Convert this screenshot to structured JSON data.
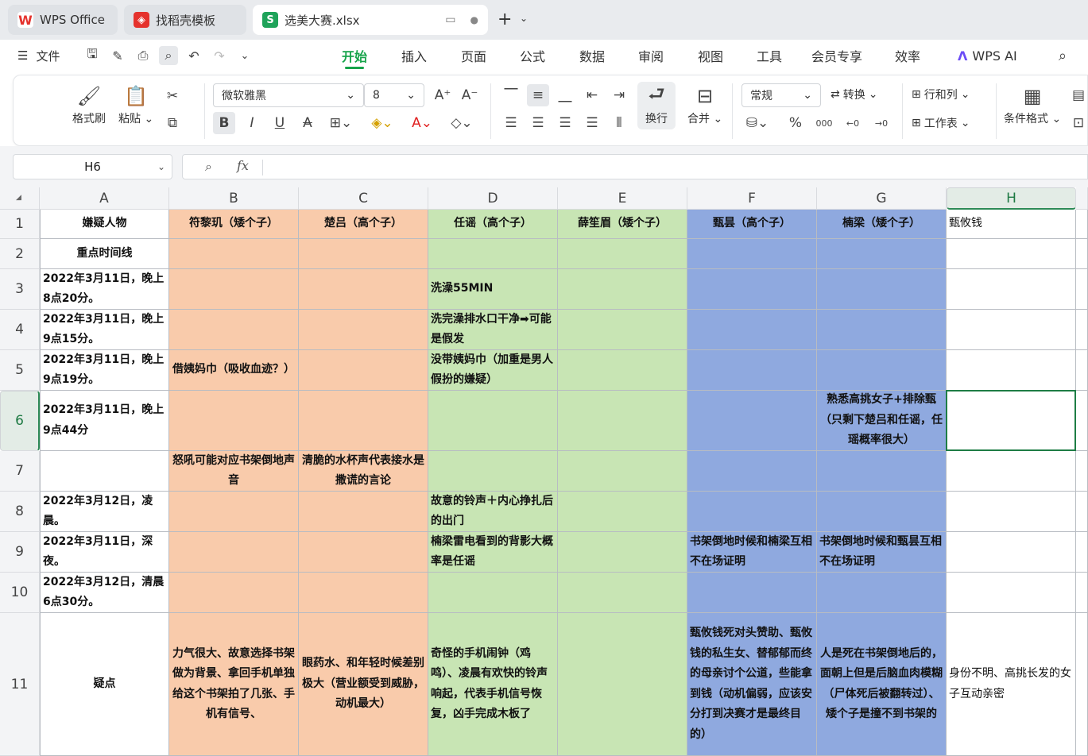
{
  "tabs": [
    {
      "label": "WPS Office"
    },
    {
      "label": "找稻壳模板"
    },
    {
      "label": "选美大赛.xlsx"
    }
  ],
  "menu": {
    "file": "文件",
    "items": [
      "开始",
      "插入",
      "页面",
      "公式",
      "数据",
      "审阅",
      "视图",
      "工具",
      "会员专享",
      "效率"
    ],
    "active": "开始",
    "ai": "WPS AI"
  },
  "ribbon": {
    "format_painter": "格式刷",
    "paste": "粘贴",
    "font_name": "微软雅黑",
    "font_size": "8",
    "number_format": "常规",
    "convert": "转换",
    "rows_cols": "行和列",
    "wrap": "换行",
    "merge": "合并",
    "worksheet": "工作表",
    "cond_format": "条件格式"
  },
  "formula": {
    "name_box": "H6",
    "fx": "fx",
    "content": ""
  },
  "columns": [
    "A",
    "B",
    "C",
    "D",
    "E",
    "F",
    "G",
    "H"
  ],
  "rows": [
    "1",
    "2",
    "3",
    "4",
    "5",
    "6",
    "7",
    "8",
    "9",
    "10",
    "11"
  ],
  "selected_cell": "H6",
  "cells": {
    "A1": "嫌疑人物",
    "B1": "符黎玑（矮个子）",
    "C1": "楚吕（高个子）",
    "D1": "任谣（高个子）",
    "E1": "薛笙眉（矮个子）",
    "F1": "甄昙（高个子）",
    "G1": "楠梁（矮个子）",
    "H1": "甄攸钱",
    "A2": "重点时间线",
    "A3": "2022年3月11日，晚上8点20分。",
    "D3": "洗澡55MIN",
    "A4": "2022年3月11日，晚上9点15分。",
    "D4": "洗完澡排水口干净➡可能是假发",
    "A5": "2022年3月11日，晚上9点19分。",
    "B5": "借姨妈巾（吸收血迹？）",
    "D5": "没带姨妈巾（加重是男人假扮的嫌疑）",
    "A6": "2022年3月11日，晚上9点44分",
    "G6": "熟悉高挑女子+排除甄（只剩下楚吕和任谣，任瑶概率很大）",
    "B7": "怒吼可能对应书架倒地声音",
    "C7": "清脆的水杯声代表接水是撒谎的言论",
    "A8": "2022年3月12日，凌晨。",
    "D8": "故意的铃声＋内心挣扎后的出门",
    "A9": "2022年3月11日，深夜。",
    "D9": "楠梁雷电看到的背影大概率是任谣",
    "F9": "书架倒地时候和楠梁互相不在场证明",
    "G9": "书架倒地时候和甄昙互相不在场证明",
    "A10": "2022年3月12日，清晨6点30分。",
    "A11": "疑点",
    "B11": "力气很大、故意选择书架做为背景、拿回手机单独给这个书架拍了几张、手机有信号、",
    "C11": "眼药水、和年轻时候差别极大（营业额受到威胁，动机最大）",
    "D11": "奇怪的手机闹钟（鸡鸣）、凌晨有欢快的铃声响起，代表手机信号恢复，凶手完成木板了",
    "F11": "甄攸钱死对头赞助、甄攸钱的私生女、替郁郁而终的母亲讨个公道，些能拿到钱（动机偏弱，应该安分打到决赛才是最终目的）",
    "G11": "人是死在书架倒地后的，面朝上但是后脑血肉模糊（尸体死后被翻转过）、矮个子是撞不到书架的",
    "H11": "身份不明、高挑长发的女子互动亲密"
  }
}
